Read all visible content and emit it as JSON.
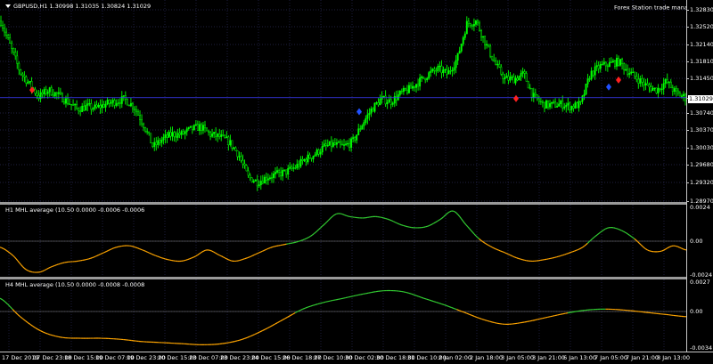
{
  "symbol": {
    "title": "GBPUSD,H1  1.30998 1.31035 1.30824 1.31029",
    "trade_manager": "Forex Station trade manager",
    "trade_manager_icon": "smiley-icon"
  },
  "price_axis": {
    "labels": [
      "1.32830",
      "1.32520",
      "1.32140",
      "1.31810",
      "1.31450",
      "1.31029",
      "1.30740",
      "1.30370",
      "1.30030",
      "1.29680",
      "1.29320",
      "1.28970"
    ],
    "current_bid": "1.31029"
  },
  "indicator1": {
    "title": "H1 MHL average (10.50 0.0000 -0.0006 -0.0006",
    "axis_labels": [
      "0.0024",
      "0.00",
      "-0.0024"
    ]
  },
  "indicator2": {
    "title": "H4 MHL average (10.50 0.0000 -0.0008 -0.0008",
    "axis_labels": [
      "0.0027",
      "0.00",
      "-0.0034"
    ]
  },
  "time_axis": {
    "labels": [
      "17 Dec 2019",
      "17 Dec 23:00",
      "18 Dec 15:00",
      "19 Dec 07:00",
      "19 Dec 23:00",
      "20 Dec 15:00",
      "23 Dec 07:00",
      "23 Dec 23:00",
      "24 Dec 15:00",
      "26 Dec 18:00",
      "27 Dec 10:00",
      "30 Dec 02:00",
      "30 Dec 18:00",
      "31 Dec 10:00",
      "2 Jan 02:00",
      "2 Jan 18:00",
      "3 Jan 05:00",
      "3 Jan 21:00",
      "6 Jan 13:00",
      "7 Jan 05:00",
      "7 Jan 21:00",
      "8 Jan 13:00"
    ]
  },
  "colors": {
    "background": "#000000",
    "bull": "#00ff00",
    "bear": "#00ff00",
    "grid": "#1e2a5a",
    "osc_up": "#32cd32",
    "osc_down": "#ffa500",
    "sell_marker": "#ff2020",
    "buy_marker": "#2050ff",
    "bid_line": "#3c3cff"
  },
  "chart_data": [
    {
      "type": "candlestick",
      "title": "GBPUSD,H1",
      "ylim": [
        1.2897,
        1.3283
      ],
      "price_path": [
        1.3255,
        1.3205,
        1.3155,
        1.313,
        1.3105,
        1.3118,
        1.3108,
        1.3095,
        1.308,
        1.3085,
        1.3082,
        1.309,
        1.3095,
        1.31,
        1.3085,
        1.305,
        1.3005,
        1.302,
        1.303,
        1.303,
        1.304,
        1.3045,
        1.303,
        1.3025,
        1.3015,
        1.299,
        1.2945,
        1.2935,
        1.2945,
        1.295,
        1.2955,
        1.2965,
        1.298,
        1.299,
        1.3005,
        1.301,
        1.3005,
        1.3015,
        1.305,
        1.308,
        1.31,
        1.3095,
        1.311,
        1.312,
        1.3135,
        1.315,
        1.316,
        1.315,
        1.318,
        1.325,
        1.3255,
        1.321,
        1.317,
        1.314,
        1.314,
        1.315,
        1.3105,
        1.309,
        1.3088,
        1.309,
        1.3085,
        1.309,
        1.315,
        1.3165,
        1.317,
        1.3175,
        1.3155,
        1.314,
        1.3125,
        1.3118,
        1.3135,
        1.3112,
        1.3103
      ],
      "series": [
        {
          "name": "sell signal",
          "points": [
            [
              36,
              1.3118
            ],
            [
              579,
              1.3101
            ],
            [
              694,
              1.3138
            ]
          ]
        },
        {
          "name": "buy signal",
          "points": [
            [
              403,
              1.3075
            ],
            [
              683,
              1.3124
            ]
          ]
        }
      ]
    },
    {
      "type": "line",
      "title": "H1 MHL average",
      "ylim": [
        -0.0024,
        0.0024
      ],
      "values": [
        -0.0004,
        -0.001,
        -0.002,
        -0.0022,
        -0.0018,
        -0.0015,
        -0.0014,
        -0.0012,
        -0.0008,
        -0.0004,
        -0.0003,
        -0.0006,
        -0.001,
        -0.0013,
        -0.0014,
        -0.0011,
        -0.0006,
        -0.001,
        -0.0014,
        -0.0012,
        -0.0008,
        -0.0004,
        -0.0002,
        0.0,
        0.0004,
        0.0012,
        0.002,
        0.0018,
        0.0017,
        0.0018,
        0.0016,
        0.0012,
        0.001,
        0.0011,
        0.0016,
        0.0022,
        0.0012,
        0.0002,
        -0.0004,
        -0.0008,
        -0.0012,
        -0.0014,
        -0.0013,
        -0.0011,
        -0.0008,
        -0.0004,
        0.0004,
        0.001,
        0.0008,
        0.0002,
        -0.0006,
        -0.0007,
        -0.0003,
        -0.0006
      ]
    },
    {
      "type": "line",
      "title": "H4 MHL average",
      "ylim": [
        -0.0034,
        0.0027
      ],
      "values": [
        0.0012,
        -0.0005,
        -0.0018,
        -0.0024,
        -0.0025,
        -0.0025,
        -0.0026,
        -0.0028,
        -0.0029,
        -0.003,
        -0.0031,
        -0.003,
        -0.0026,
        -0.0018,
        -0.0008,
        0.0002,
        0.0008,
        0.0012,
        0.0016,
        0.0019,
        0.0018,
        0.0012,
        0.0006,
        -0.0001,
        -0.0008,
        -0.0012,
        -0.001,
        -0.0006,
        -0.0002,
        0.0001,
        0.0002,
        0.0001,
        -0.0001,
        -0.0003,
        -0.0005
      ]
    }
  ]
}
